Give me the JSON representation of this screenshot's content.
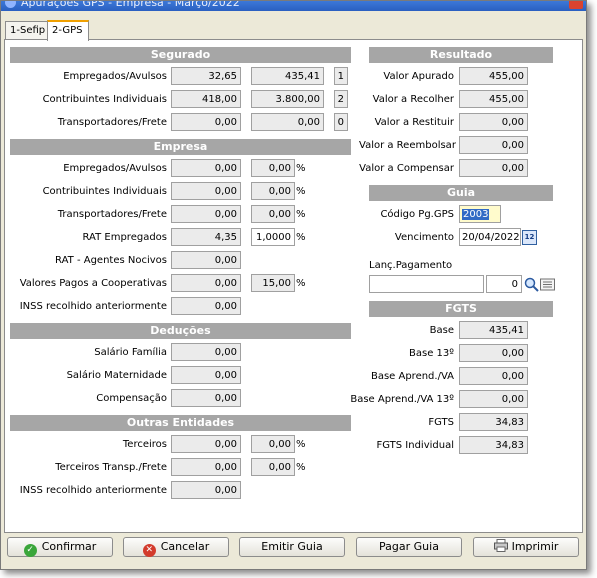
{
  "window": {
    "title": "Apurações GPS - Empresa - Março/2022"
  },
  "tabs": [
    {
      "label": "1-Sefip"
    },
    {
      "label": "2-GPS"
    }
  ],
  "segurado": {
    "header": "Segurado",
    "rows": [
      {
        "label": "Empregados/Avulsos",
        "v1": "32,65",
        "v2": "435,41",
        "v3": "1"
      },
      {
        "label": "Contribuintes Individuais",
        "v1": "418,00",
        "v2": "3.800,00",
        "v3": "2"
      },
      {
        "label": "Transportadores/Frete",
        "v1": "0,00",
        "v2": "0,00",
        "v3": "0"
      }
    ]
  },
  "empresa": {
    "header": "Empresa",
    "rows": [
      {
        "label": "Empregados/Avulsos",
        "v1": "0,00",
        "v2": "0,00",
        "unit": "%"
      },
      {
        "label": "Contribuintes Individuais",
        "v1": "0,00",
        "v2": "0,00",
        "unit": "%"
      },
      {
        "label": "Transportadores/Frete",
        "v1": "0,00",
        "v2": "0,00",
        "unit": "%"
      },
      {
        "label": "RAT Empregados",
        "v1": "4,35",
        "v2": "1,0000",
        "unit": "%"
      },
      {
        "label": "RAT - Agentes Nocivos",
        "v1": "0,00"
      },
      {
        "label": "Valores Pagos a Cooperativas",
        "v1": "0,00",
        "v2": "15,00",
        "unit": "%"
      },
      {
        "label": "INSS recolhido anteriormente",
        "v1": "0,00"
      }
    ]
  },
  "deducoes": {
    "header": "Deduções",
    "rows": [
      {
        "label": "Salário Família",
        "v1": "0,00"
      },
      {
        "label": "Salário Maternidade",
        "v1": "0,00"
      },
      {
        "label": "Compensação",
        "v1": "0,00"
      }
    ]
  },
  "outras": {
    "header": "Outras Entidades",
    "rows": [
      {
        "label": "Terceiros",
        "v1": "0,00",
        "v2": "0,00",
        "unit": "%"
      },
      {
        "label": "Terceiros Transp./Frete",
        "v1": "0,00",
        "v2": "0,00",
        "unit": "%"
      },
      {
        "label": "INSS recolhido anteriormente",
        "v1": "0,00"
      }
    ]
  },
  "resultado": {
    "header": "Resultado",
    "rows": [
      {
        "label": "Valor Apurado",
        "value": "455,00"
      },
      {
        "label": "Valor a Recolher",
        "value": "455,00"
      },
      {
        "label": "Valor a Restituir",
        "value": "0,00"
      },
      {
        "label": "Valor a Reembolsar",
        "value": "0,00"
      },
      {
        "label": "Valor a Compensar",
        "value": "0,00"
      }
    ]
  },
  "guia": {
    "header": "Guia",
    "codigo_label": "Código Pg.GPS",
    "codigo_value": "2003",
    "vencimento_label": "Vencimento",
    "vencimento_value": "20/04/2022",
    "calendar_text": "12",
    "lanc_label": "Lanç.Pagamento",
    "lanc_text": "",
    "lanc_number": "0"
  },
  "fgts": {
    "header": "FGTS",
    "rows": [
      {
        "label": "Base",
        "value": "435,41"
      },
      {
        "label": "Base 13º",
        "value": "0,00"
      },
      {
        "label": "Base Aprend./VA",
        "value": "0,00"
      },
      {
        "label": "Base Aprend./VA 13º",
        "value": "0,00"
      },
      {
        "label": "FGTS",
        "value": "34,83"
      },
      {
        "label": "FGTS Individual",
        "value": "34,83"
      }
    ]
  },
  "buttons": {
    "confirmar": "Confirmar",
    "cancelar": "Cancelar",
    "emitir": "Emitir Guia",
    "pagar": "Pagar Guia",
    "imprimir": "Imprimir"
  },
  "colors": {
    "header_bg": "#a6a6a6",
    "readonly_bg": "#ebebeb",
    "edit_bg": "#fffbcc",
    "confirm_green": "#3aa63a",
    "cancel_red": "#d33b2c"
  }
}
